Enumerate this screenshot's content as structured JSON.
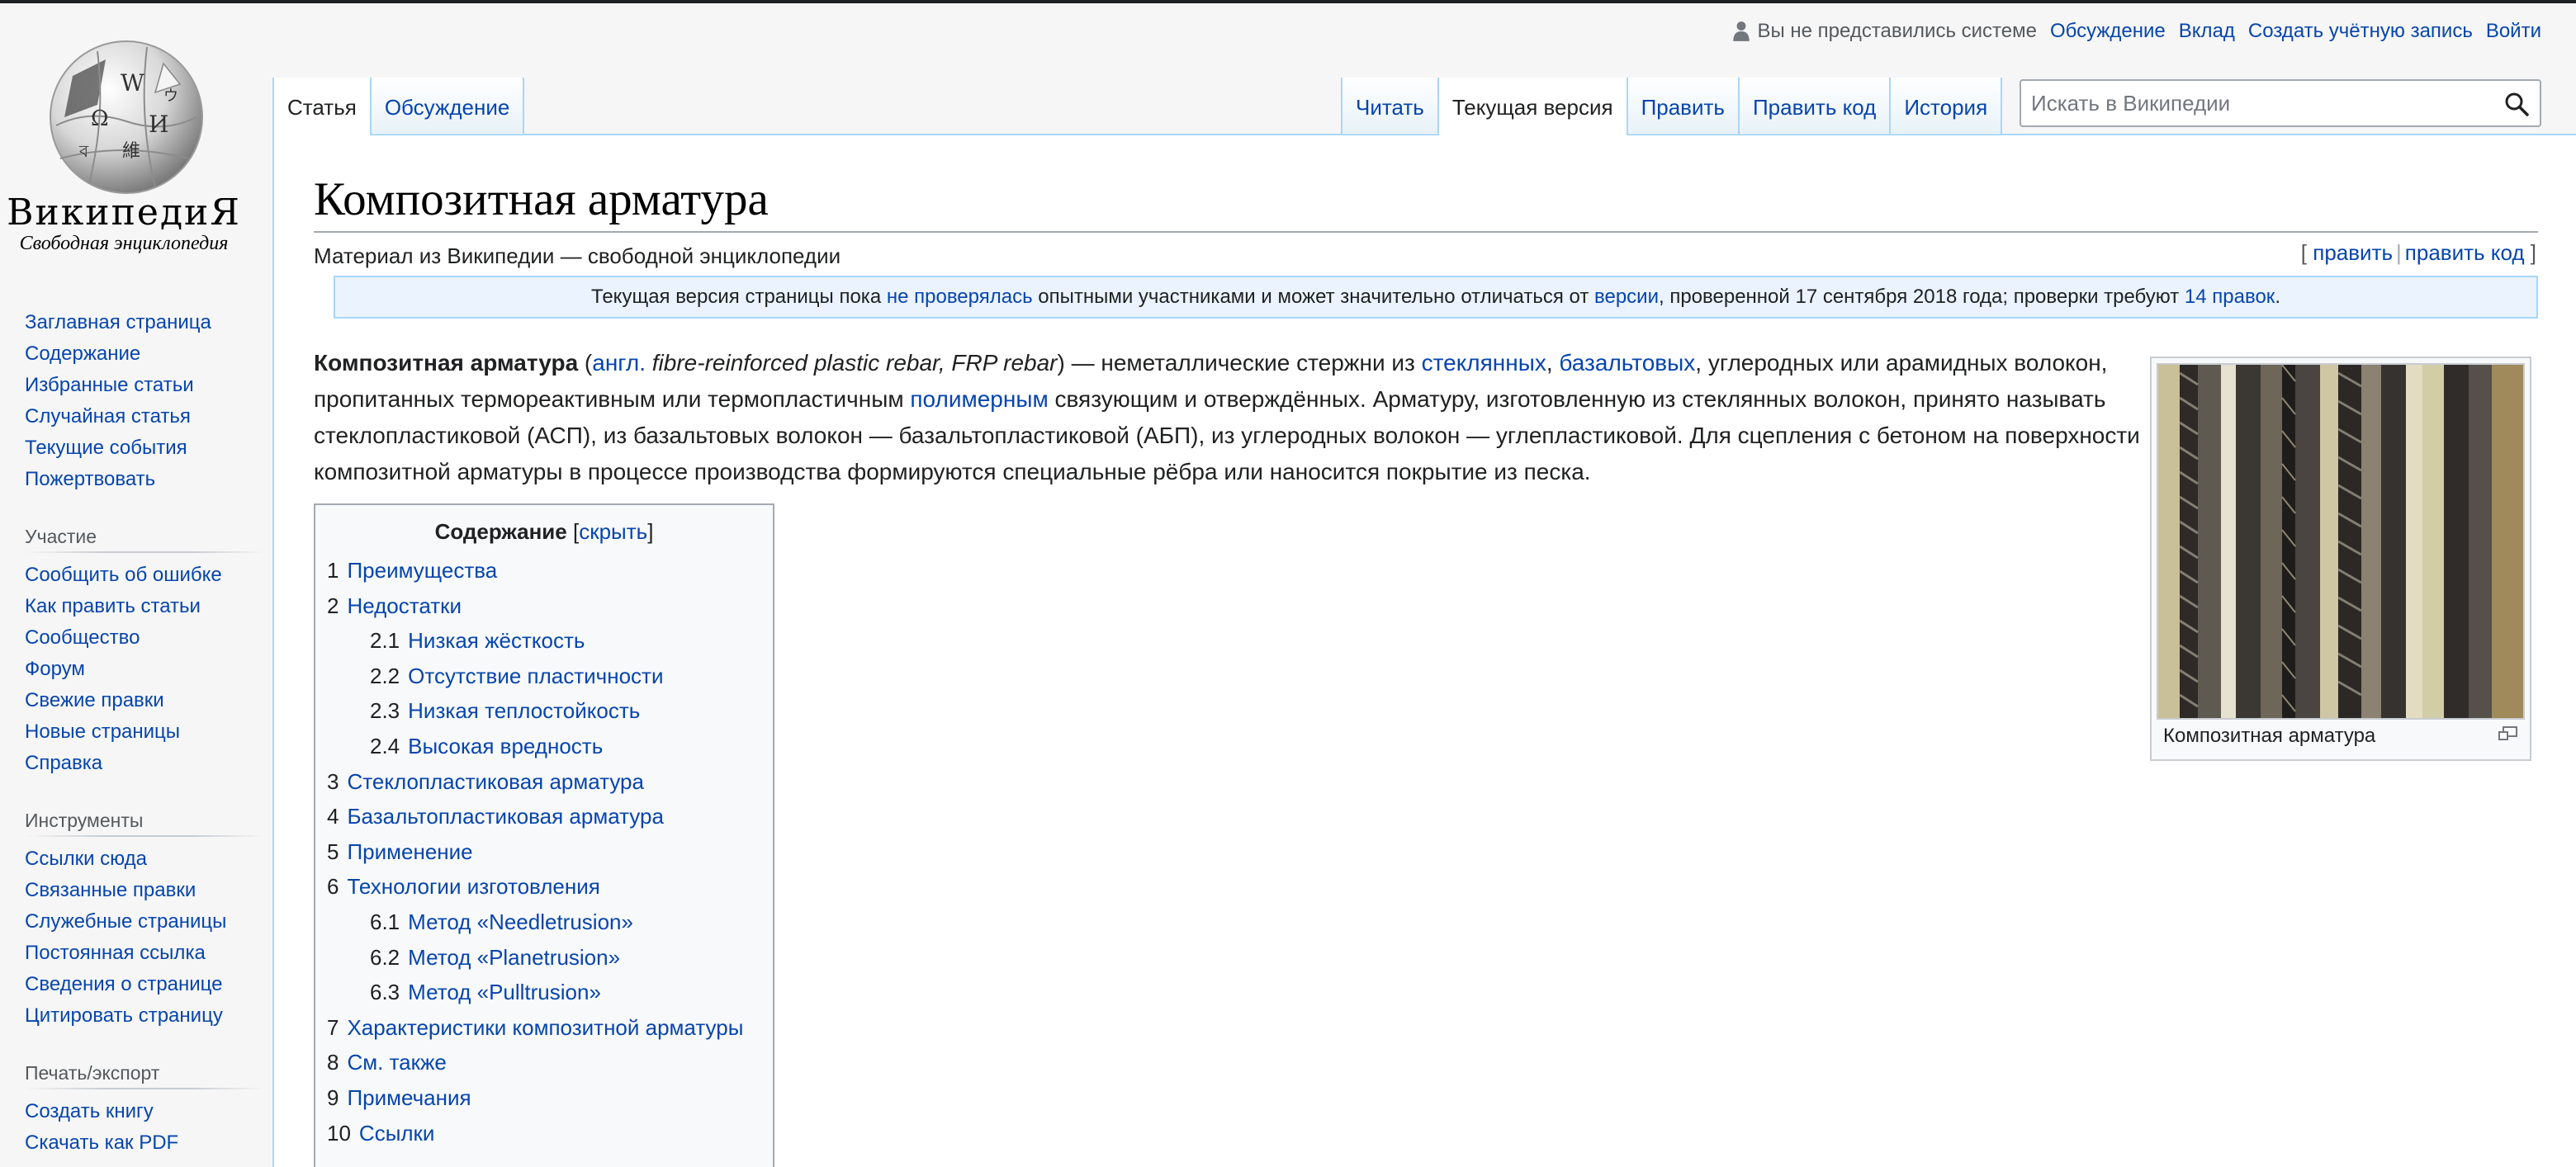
{
  "logo": {
    "wordmark": "ВикипедиЯ",
    "tagline": "Свободная энциклопедия"
  },
  "personal": {
    "status": "Вы не представились системе",
    "links": [
      "Обсуждение",
      "Вклад",
      "Создать учётную запись",
      "Войти"
    ]
  },
  "tabs": {
    "left": [
      "Статья",
      "Обсуждение"
    ],
    "right": [
      "Читать",
      "Текущая версия",
      "Править",
      "Править код",
      "История"
    ]
  },
  "search": {
    "placeholder": "Искать в Википедии"
  },
  "sidebar": {
    "nav": [
      "Заглавная страница",
      "Содержание",
      "Избранные статьи",
      "Случайная статья",
      "Текущие события",
      "Пожертвовать"
    ],
    "participation": {
      "title": "Участие",
      "items": [
        "Сообщить об ошибке",
        "Как править статьи",
        "Сообщество",
        "Форум",
        "Свежие правки",
        "Новые страницы",
        "Справка"
      ]
    },
    "tools": {
      "title": "Инструменты",
      "items": [
        "Ссылки сюда",
        "Связанные правки",
        "Служебные страницы",
        "Постоянная ссылка",
        "Сведения о странице",
        "Цитировать страницу"
      ]
    },
    "print": {
      "title": "Печать/экспорт",
      "items": [
        "Создать книгу",
        "Скачать как PDF"
      ]
    }
  },
  "article": {
    "title": "Композитная арматура",
    "site_sub": "Материал из Википедии — свободной энциклопедии",
    "edit": "править",
    "edit_code": "править код",
    "flagged": {
      "t1": "Текущая версия страницы пока ",
      "l1": "не проверялась",
      "t2": " опытными участниками и может значительно отличаться от ",
      "l2": "версии",
      "t3": ", проверенной 17 сентября 2018 года; проверки требуют ",
      "l3": "14 правок",
      "t4": "."
    },
    "lead": {
      "bold": "Композитная арматура",
      "t1": " (",
      "l_lang": "англ.",
      "italic": " fibre-reinforced plastic rebar, FRP rebar",
      "t2": ") — неметаллические стержни из ",
      "l_glass": "стеклянных",
      "t3": ", ",
      "l_basalt": "базальтовых",
      "t4": ", углеродных или арамидных волокон, пропитанных термореактивным или термопластичным ",
      "l_polymer": "полимерным",
      "t5": " связующим и отверждённых. Арматуру, изготовленную из стеклянных волокон, принято называть стеклопластиковой (АСП), из базальтовых волокон — базальтопластиковой (АБП), из углеродных волокон — углепластиковой. Для сцепления с бетоном на поверхности композитной арматуры в процессе производства формируются специальные рёбра или наносится покрытие из песка."
    },
    "thumb_caption": "Композитная арматура",
    "toc": {
      "title": "Содержание",
      "hide": "скрыть",
      "items": [
        {
          "num": "1",
          "text": "Преимущества",
          "level": 1
        },
        {
          "num": "2",
          "text": "Недостатки",
          "level": 1
        },
        {
          "num": "2.1",
          "text": "Низкая жёсткость",
          "level": 2
        },
        {
          "num": "2.2",
          "text": "Отсутствие пластичности",
          "level": 2
        },
        {
          "num": "2.3",
          "text": "Низкая теплостойкость",
          "level": 2
        },
        {
          "num": "2.4",
          "text": "Высокая вредность",
          "level": 2
        },
        {
          "num": "3",
          "text": "Стеклопластиковая арматура",
          "level": 1
        },
        {
          "num": "4",
          "text": "Базальтопластиковая арматура",
          "level": 1
        },
        {
          "num": "5",
          "text": "Применение",
          "level": 1
        },
        {
          "num": "6",
          "text": "Технологии изготовления",
          "level": 1
        },
        {
          "num": "6.1",
          "text": "Метод «Needletrusion»",
          "level": 2
        },
        {
          "num": "6.2",
          "text": "Метод «Planetrusion»",
          "level": 2
        },
        {
          "num": "6.3",
          "text": "Метод «Pulltrusion»",
          "level": 2
        },
        {
          "num": "7",
          "text": "Характеристики композитной арматуры",
          "level": 1
        },
        {
          "num": "8",
          "text": "См. также",
          "level": 1
        },
        {
          "num": "9",
          "text": "Примечания",
          "level": 1
        },
        {
          "num": "10",
          "text": "Ссылки",
          "level": 1
        }
      ]
    }
  },
  "colors": {
    "link": "#0645ad",
    "text": "#202122",
    "tab_border": "#a7d7f9",
    "flagged_bg": "#eaf3ff",
    "toc_bg": "#f8f9fa"
  }
}
